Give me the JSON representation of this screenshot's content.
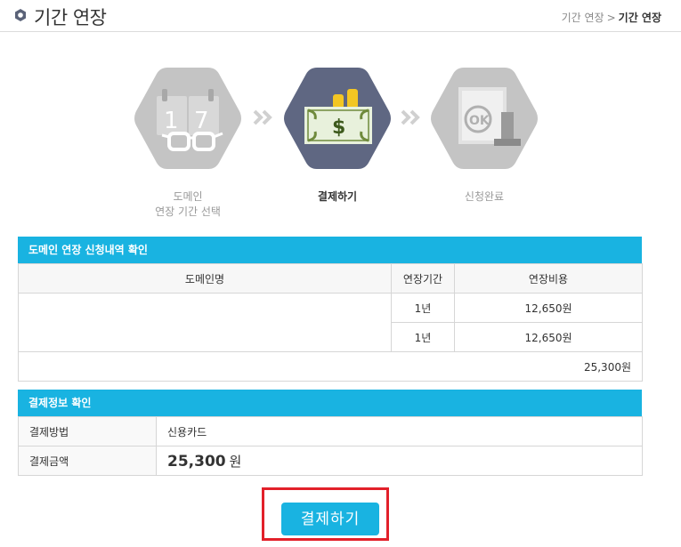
{
  "header": {
    "title": "기간 연장",
    "breadcrumb": [
      "기간 연장",
      "기간 연장"
    ],
    "breadcrumb_separator": ">"
  },
  "steps": [
    {
      "label_line1": "도메인",
      "label_line2": "연장 기간 선택",
      "icon": "calendar-glasses-icon",
      "state": "inactive"
    },
    {
      "label_line1": "결제하기",
      "label_line2": "",
      "icon": "money-icon",
      "state": "active"
    },
    {
      "label_line1": "신청완료",
      "label_line2": "",
      "icon": "ok-stamp-icon",
      "state": "inactive"
    }
  ],
  "domain_table": {
    "title": "도메인 연장 신청내역 확인",
    "headers": [
      "도메인명",
      "연장기간",
      "연장비용"
    ],
    "rows": [
      {
        "domain": "",
        "period": "1년",
        "cost": "12,650원"
      },
      {
        "domain": "",
        "period": "1년",
        "cost": "12,650원"
      }
    ],
    "total": "25,300원"
  },
  "payment": {
    "title": "결제정보 확인",
    "method_label": "결제방법",
    "method_value": "신용카드",
    "amount_label": "결제금액",
    "amount_value": "25,300",
    "amount_unit": "원"
  },
  "submit": {
    "label": "결제하기"
  },
  "colors": {
    "accent": "#19b3e1",
    "active_step": "#5f6782",
    "inactive_step": "#c4c4c4",
    "highlight": "#e2202a"
  }
}
